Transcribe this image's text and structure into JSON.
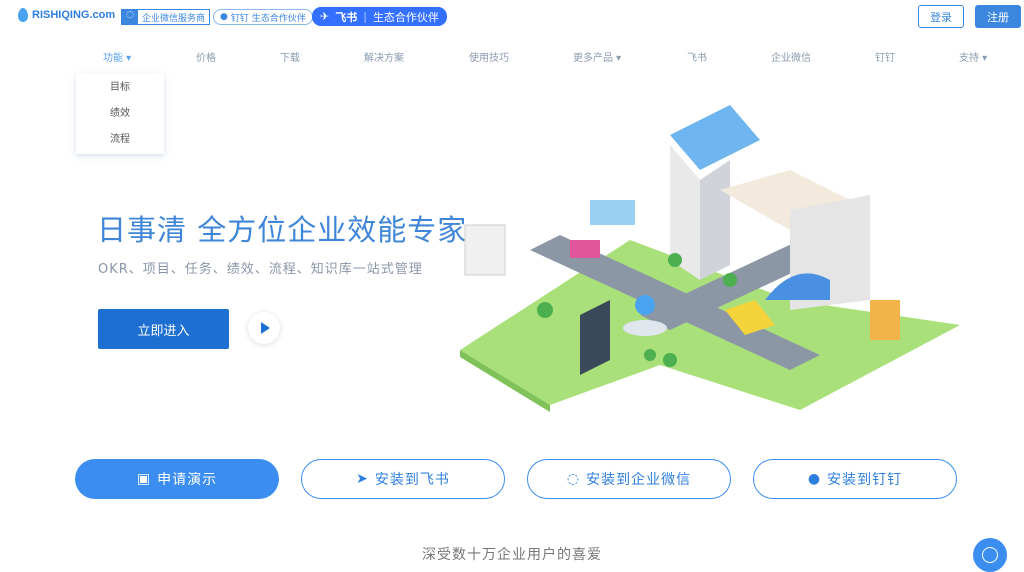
{
  "header": {
    "logo_text": "RISHIQING.com",
    "badge_wecom": "企业微信服务商",
    "badge_dingtalk": "钉钉 生态合作伙伴",
    "badge_feishu_brand": "飞书",
    "badge_feishu_text": "生态合作伙伴",
    "login": "登录",
    "register": "注册"
  },
  "nav": {
    "items": [
      {
        "label": "功能 ▾"
      },
      {
        "label": "价格"
      },
      {
        "label": "下载"
      },
      {
        "label": "解决方案"
      },
      {
        "label": "使用技巧"
      },
      {
        "label": "更多产品 ▾"
      },
      {
        "label": "飞书"
      },
      {
        "label": "企业微信"
      },
      {
        "label": "钉钉"
      },
      {
        "label": "支持 ▾"
      }
    ],
    "dropdown": [
      "目标",
      "绩效",
      "流程"
    ]
  },
  "hero": {
    "title": "日事清 全方位企业效能专家",
    "subtitle": "OKR、项目、任务、绩效、流程、知识库一站式管理",
    "enter_button": "立即进入"
  },
  "cta": {
    "demo": "申请演示",
    "feishu": "安装到飞书",
    "wecom": "安装到企业微信",
    "dingtalk": "安装到钉钉"
  },
  "footer_heading": "深受数十万企业用户的喜爱",
  "colors": {
    "accent": "#3b8ef0",
    "primary_button": "#1e6fd2",
    "feishu": "#3370ff"
  }
}
